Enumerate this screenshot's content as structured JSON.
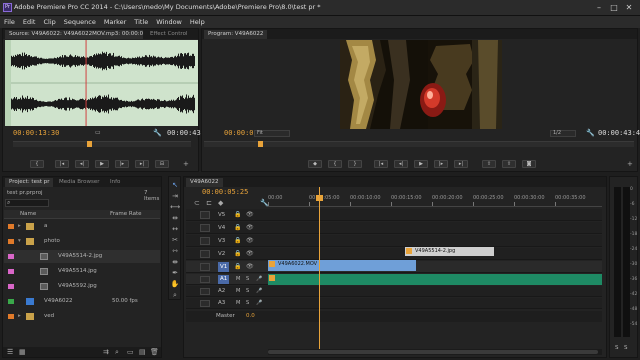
{
  "app": {
    "title": "Adobe Premiere Pro CC 2014 - C:\\Users\\medo\\My Documents\\Adobe\\Premiere Pro\\8.0\\test pr *",
    "icon_text": "Pr"
  },
  "menu": [
    "File",
    "Edit",
    "Clip",
    "Sequence",
    "Marker",
    "Title",
    "Window",
    "Help"
  ],
  "source_monitor": {
    "tabs": [
      "Source: V49A6022: V49A6022MOV.mp3: 00:00:00:00",
      "Effect Control"
    ],
    "timecode_in": "00:00:13:30",
    "timecode_out": "00:00:43:42",
    "playhead_fraction": 0.42
  },
  "program_monitor": {
    "tab": "Program: V49A6022",
    "timecode": "00:00:05:25",
    "fit_label": "Fit",
    "quality_label": "1/2",
    "duration": "00:00:43:42"
  },
  "project": {
    "tabs": [
      "Project: test pr",
      "Media Browser",
      "Info"
    ],
    "file": "test pr.prproj",
    "item_count": "7 Items",
    "columns": [
      "Name",
      "Frame Rate"
    ],
    "rows": [
      {
        "name": "a",
        "rate": "",
        "kind": "folder",
        "color": "#e07a2a",
        "indent": 0
      },
      {
        "name": "photo",
        "rate": "",
        "kind": "folder-open",
        "color": "#e07a2a",
        "indent": 0
      },
      {
        "name": "V49A5514-2.jpg",
        "rate": "",
        "kind": "image",
        "color": "#d966c8",
        "indent": 1
      },
      {
        "name": "V49A5514.jpg",
        "rate": "",
        "kind": "image",
        "color": "#d966c8",
        "indent": 1
      },
      {
        "name": "V49A5592.jpg",
        "rate": "",
        "kind": "image",
        "color": "#d966c8",
        "indent": 1
      },
      {
        "name": "V49A6022",
        "rate": "50.00 fps",
        "kind": "sequence",
        "color": "#3aa84a",
        "indent": 0
      },
      {
        "name": "ved",
        "rate": "",
        "kind": "folder",
        "color": "#e07a2a",
        "indent": 0
      }
    ]
  },
  "timeline": {
    "tab": "V49A6022",
    "timecode": "00:00:05:25",
    "ruler": [
      "00:00",
      "00:00:05:00",
      "00:00:10:00",
      "00:00:15:00",
      "00:00:20:00",
      "00:00:25:00",
      "00:00:30:00",
      "00:00:35:00"
    ],
    "video_tracks": [
      "V5",
      "V4",
      "V3",
      "V2",
      "V1"
    ],
    "audio_tracks": [
      "A1",
      "A2",
      "A3"
    ],
    "master_label": "Master",
    "master_value": "0.0",
    "track_letters": {
      "mute": "M",
      "solo": "S"
    },
    "clip_v2": "V49A5514-2.jpg",
    "clip_v1": "V49A6022.MOV"
  },
  "meter": {
    "scale": [
      "0",
      "-6",
      "-12",
      "-18",
      "-24",
      "-30",
      "-36",
      "-42",
      "-48",
      "-54"
    ],
    "labels": [
      "S",
      "S"
    ]
  },
  "colors": {
    "accent_timecode": "#e8a33a",
    "video_clip": "#6f9fd8",
    "audio_clip": "#1e8a64",
    "image_clip": "#cfcfcf",
    "playhead": "#e8a33a"
  }
}
